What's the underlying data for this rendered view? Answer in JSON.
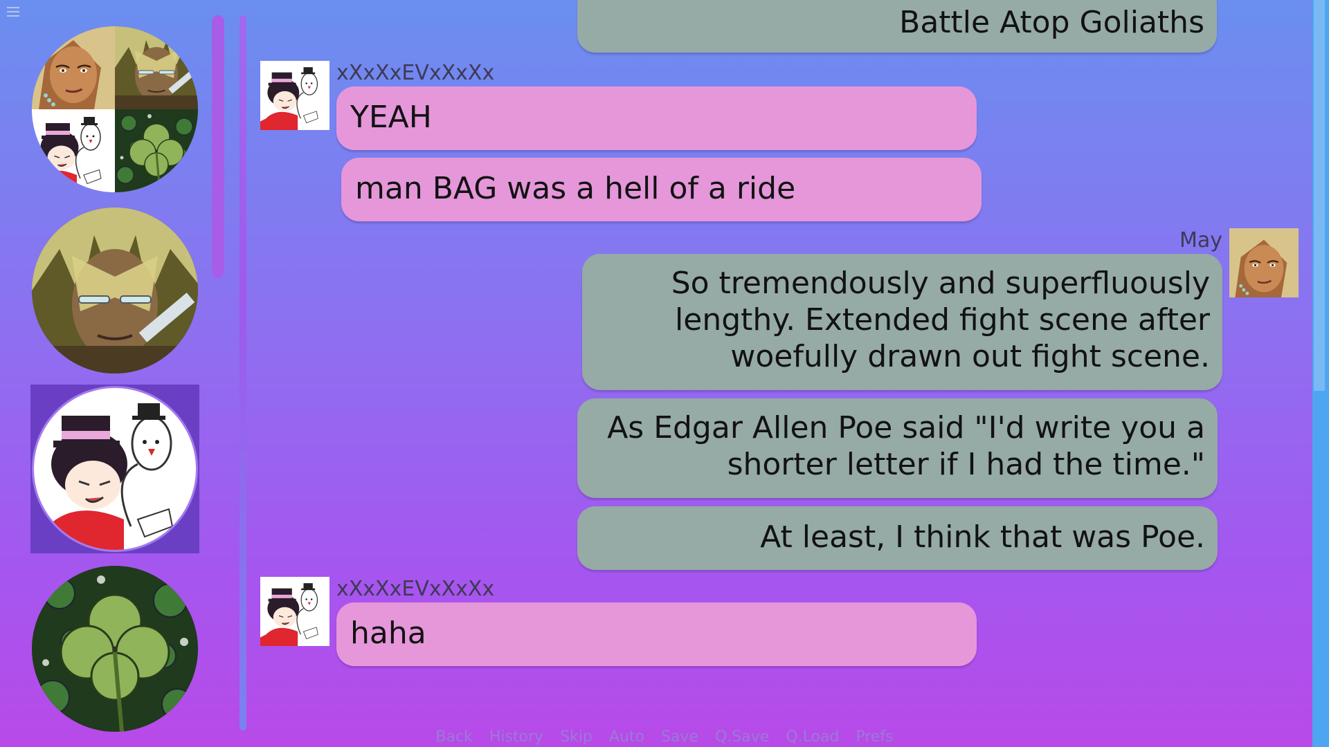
{
  "menu": {
    "icon": "hamburger-menu-icon"
  },
  "contacts": [
    {
      "name": "group-chat",
      "icon": "group-avatar-collage",
      "active": false
    },
    {
      "name": "blonde-man",
      "icon": "blonde-man-avatar",
      "active": false
    },
    {
      "name": "xXxXxEVxXxXx",
      "icon": "top-hat-girl-avatar",
      "active": true
    },
    {
      "name": "clover",
      "icon": "clover-avatar",
      "active": false
    }
  ],
  "messages": [
    {
      "side": "mine",
      "text": "Battle Atop Goliaths"
    },
    {
      "side": "theirs",
      "sender": "xXxXxEVxXxXx",
      "text": "YEAH"
    },
    {
      "side": "theirs",
      "text": "man BAG was a hell of a ride"
    },
    {
      "side": "mine",
      "sender": "May",
      "lines": [
        "So tremendously and superfluously",
        "lengthy. Extended fight scene after",
        "woefully drawn out fight scene."
      ]
    },
    {
      "side": "mine",
      "lines": [
        "As Edgar Allen Poe said \"I'd write you a",
        "shorter letter if I had the time.\""
      ]
    },
    {
      "side": "mine",
      "text": "At least, I think that was Poe."
    },
    {
      "side": "theirs",
      "sender": "xXxXxEVxXxXx",
      "text": "haha"
    }
  ],
  "quick_menu": [
    "Back",
    "History",
    "Skip",
    "Auto",
    "Save",
    "Q.Save",
    "Q.Load",
    "Prefs"
  ],
  "colors": {
    "their_bubble": "#e597da",
    "my_bubble": "#96aaa6",
    "active_contact": "#6a3fc4"
  }
}
